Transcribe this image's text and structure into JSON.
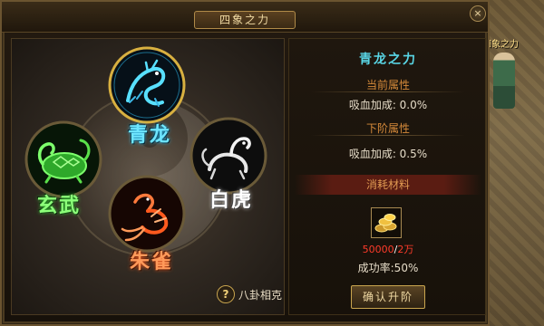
{
  "window": {
    "title": "四象之力",
    "close_label": "×"
  },
  "world": {
    "npc_name": "四象之力"
  },
  "beasts": [
    {
      "label": "青龙",
      "color": "#6fe6ff",
      "glow": "#2fc8ff",
      "icon": "dragon-icon"
    },
    {
      "label": "玄武",
      "color": "#8dff7a",
      "glow": "#3edc3c",
      "icon": "tortoise-icon"
    },
    {
      "label": "白虎",
      "color": "#ffffff",
      "glow": "#d8d8d8",
      "icon": "tiger-icon"
    },
    {
      "label": "朱雀",
      "color": "#ff9a5a",
      "glow": "#ff5a1e",
      "icon": "phoenix-icon"
    }
  ],
  "hint": {
    "icon": "?",
    "text": "八卦相克"
  },
  "info": {
    "title": "青龙之力",
    "current_header": "当前属性",
    "current_stat": "吸血加成: 0.0%",
    "next_header": "下阶属性",
    "next_stat": "吸血加成: 0.5%",
    "consume_header": "消耗材料",
    "item_icon": "gold-coins-icon",
    "have": "50000",
    "separator": "/",
    "need": "2万",
    "success_rate": "成功率:50%",
    "confirm_label": "确认升阶"
  }
}
